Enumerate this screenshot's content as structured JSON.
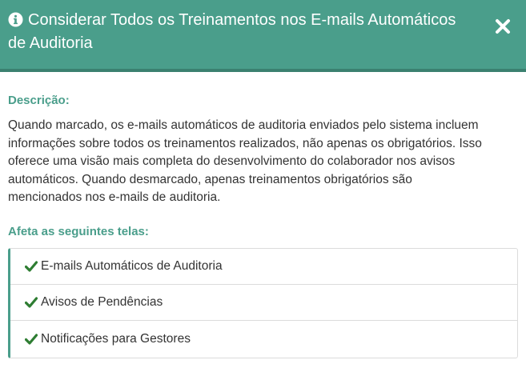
{
  "header": {
    "title": "Considerar Todos os Treinamentos nos E-mails Automáticos de Auditoria",
    "info_icon": "info-circle-icon",
    "close_icon": "close-x-icon"
  },
  "description": {
    "label": "Descrição:",
    "text": "Quando marcado, os e-mails automáticos de auditoria enviados pelo sistema incluem informações sobre todos os treinamentos realizados, não apenas os obrigatórios. Isso oferece uma visão mais completa do desenvolvimento do colaborador nos avisos automáticos. Quando desmarcado, apenas treinamentos obrigatórios são mencionados nos e-mails de auditoria."
  },
  "affects": {
    "label": "Afeta as seguintes telas:",
    "items": [
      {
        "label": "E-mails Automáticos de Auditoria"
      },
      {
        "label": "Avisos de Pendências"
      },
      {
        "label": "Notificações para Gestores"
      }
    ],
    "item_icon": "check-icon"
  },
  "colors": {
    "header_bg": "#4a9e8b",
    "accent": "#4a9e8b",
    "check": "#2e7d32",
    "text": "#333333"
  }
}
